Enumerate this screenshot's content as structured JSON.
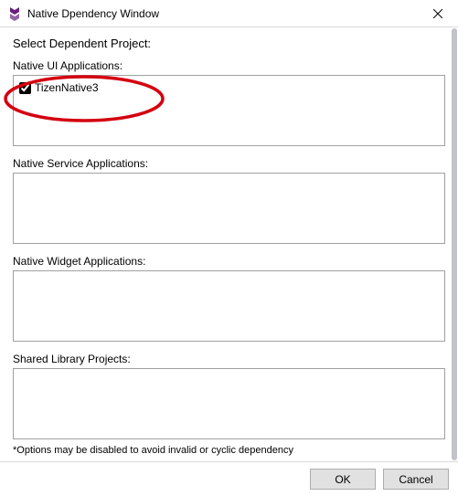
{
  "window": {
    "title": "Native Dpendency Window"
  },
  "heading": "Select Dependent Project:",
  "sections": {
    "ui": {
      "label": "Native UI Applications:",
      "items": [
        {
          "label": "TizenNative3",
          "checked": true
        }
      ]
    },
    "service": {
      "label": "Native Service Applications:"
    },
    "widget": {
      "label": "Native Widget Applications:"
    },
    "shared": {
      "label": "Shared Library Projects:"
    }
  },
  "disclaimer": "*Options may be disabled to avoid invalid or cyclic dependency",
  "buttons": {
    "ok": "OK",
    "cancel": "Cancel"
  }
}
